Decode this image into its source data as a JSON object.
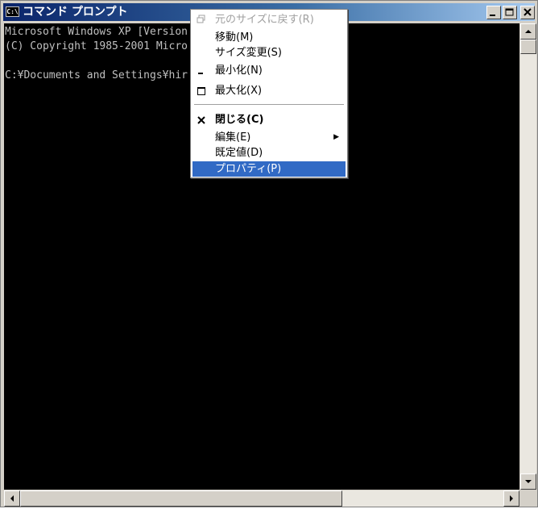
{
  "window": {
    "title": "コマンド プロンプト",
    "icon_label": "C:\\",
    "icon": "console-icon",
    "buttons": [
      "minimize-icon",
      "maximize-icon",
      "close-icon"
    ]
  },
  "console": {
    "lines": [
      "Microsoft Windows XP [Version",
      "(C) Copyright 1985-2001 Micro",
      "C:¥Documents and Settings¥hir"
    ]
  },
  "system_menu": {
    "items": [
      {
        "label": "元のサイズに戻す(R)",
        "icon": "restore-icon",
        "state": "disabled"
      },
      {
        "label": "移動(M)",
        "icon": "",
        "state": "normal"
      },
      {
        "label": "サイズ変更(S)",
        "icon": "",
        "state": "normal"
      },
      {
        "label": "最小化(N)",
        "icon": "minimize-icon",
        "state": "normal"
      },
      {
        "label": "最大化(X)",
        "icon": "maximize-icon",
        "state": "normal"
      },
      {
        "label": "閉じる(C)",
        "icon": "close-icon",
        "state": "bold"
      },
      {
        "label": "編集(E)",
        "icon": "submenu-arrow-icon",
        "state": "normal"
      },
      {
        "label": "既定値(D)",
        "icon": "",
        "state": "normal"
      },
      {
        "label": "プロパティ(P)",
        "icon": "",
        "state": "selected"
      }
    ]
  },
  "colors": {
    "titlebar_start": "#0a246a",
    "titlebar_end": "#a6caf0",
    "console_bg": "#000000",
    "console_fg": "#c0c0c0",
    "menu_highlight": "#316ac5"
  }
}
